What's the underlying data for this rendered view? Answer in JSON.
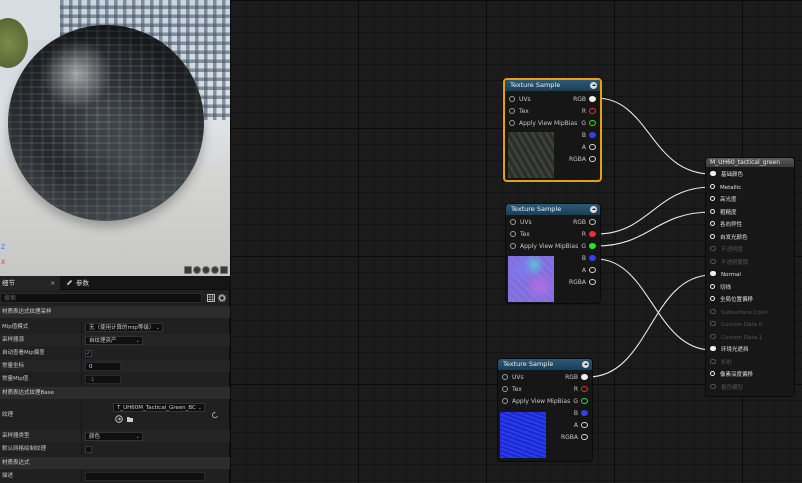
{
  "viewport": {
    "axis_z": "Z",
    "axis_x": "X"
  },
  "details": {
    "tabs": [
      {
        "label": "细节",
        "close": "×"
      },
      {
        "label": "参数"
      }
    ],
    "search_placeholder": "搜索",
    "section_uv": "材质表达式纹理采样",
    "rows_uv": [
      {
        "label": "Mip值模式",
        "value": "无（使用计算的mip等级）",
        "kind": "combo"
      },
      {
        "label": "采样器源",
        "value": "自纹理资产",
        "kind": "combo"
      },
      {
        "label": "自动查看Mip偏差",
        "value": "",
        "kind": "check-on"
      },
      {
        "label": "常量坐标",
        "value": "0",
        "kind": "number"
      },
      {
        "label": "常量Mip值",
        "value": "-1",
        "kind": "number-dim"
      }
    ],
    "section_base": "材质表达式纹理Base",
    "texture_label": "纹理",
    "texture_value": "T_UH60M_Tactical_Green_BC",
    "rows_base": [
      {
        "label": "采样器类型",
        "value": "颜色",
        "kind": "combo"
      },
      {
        "label": "默认网格绘制纹理",
        "value": "",
        "kind": "check-off"
      }
    ],
    "section_expr": "材质表达式",
    "desc_label": "描述"
  },
  "nodes": {
    "tex1": {
      "title": "Texture Sample",
      "inputs": [
        "UVs",
        "Tex",
        "Apply View MipBias"
      ],
      "outputs": [
        "RGB",
        "R",
        "G",
        "B",
        "A",
        "RGBA"
      ]
    },
    "tex2": {
      "title": "Texture Sample",
      "inputs": [
        "UVs",
        "Tex",
        "Apply View MipBias"
      ],
      "outputs": [
        "RGB",
        "R",
        "G",
        "B",
        "A",
        "RGBA"
      ]
    },
    "tex3": {
      "title": "Texture Sample",
      "inputs": [
        "UVs",
        "Tex",
        "Apply View MipBias"
      ],
      "outputs": [
        "RGB",
        "R",
        "G",
        "B",
        "A",
        "RGBA"
      ]
    }
  },
  "material": {
    "title": "M_UH60_tactical_green",
    "pins": [
      {
        "label": "基础颜色",
        "enabled": true
      },
      {
        "label": "Metallic",
        "enabled": true
      },
      {
        "label": "高光度",
        "enabled": true
      },
      {
        "label": "粗糙度",
        "enabled": true
      },
      {
        "label": "各向异性",
        "enabled": true
      },
      {
        "label": "自发光颜色",
        "enabled": true
      },
      {
        "label": "不透明度",
        "enabled": false
      },
      {
        "label": "不透明蒙版",
        "enabled": false
      },
      {
        "label": "Normal",
        "enabled": true
      },
      {
        "label": "切线",
        "enabled": true
      },
      {
        "label": "全局位置偏移",
        "enabled": true
      },
      {
        "label": "Subsurface Color",
        "enabled": false
      },
      {
        "label": "Custom Data 0",
        "enabled": false
      },
      {
        "label": "Custom Data 1",
        "enabled": false
      },
      {
        "label": "环境光遮挡",
        "enabled": true
      },
      {
        "label": "折射",
        "enabled": false
      },
      {
        "label": "像素深度偏移",
        "enabled": true
      },
      {
        "label": "着色模型",
        "enabled": false
      }
    ]
  }
}
